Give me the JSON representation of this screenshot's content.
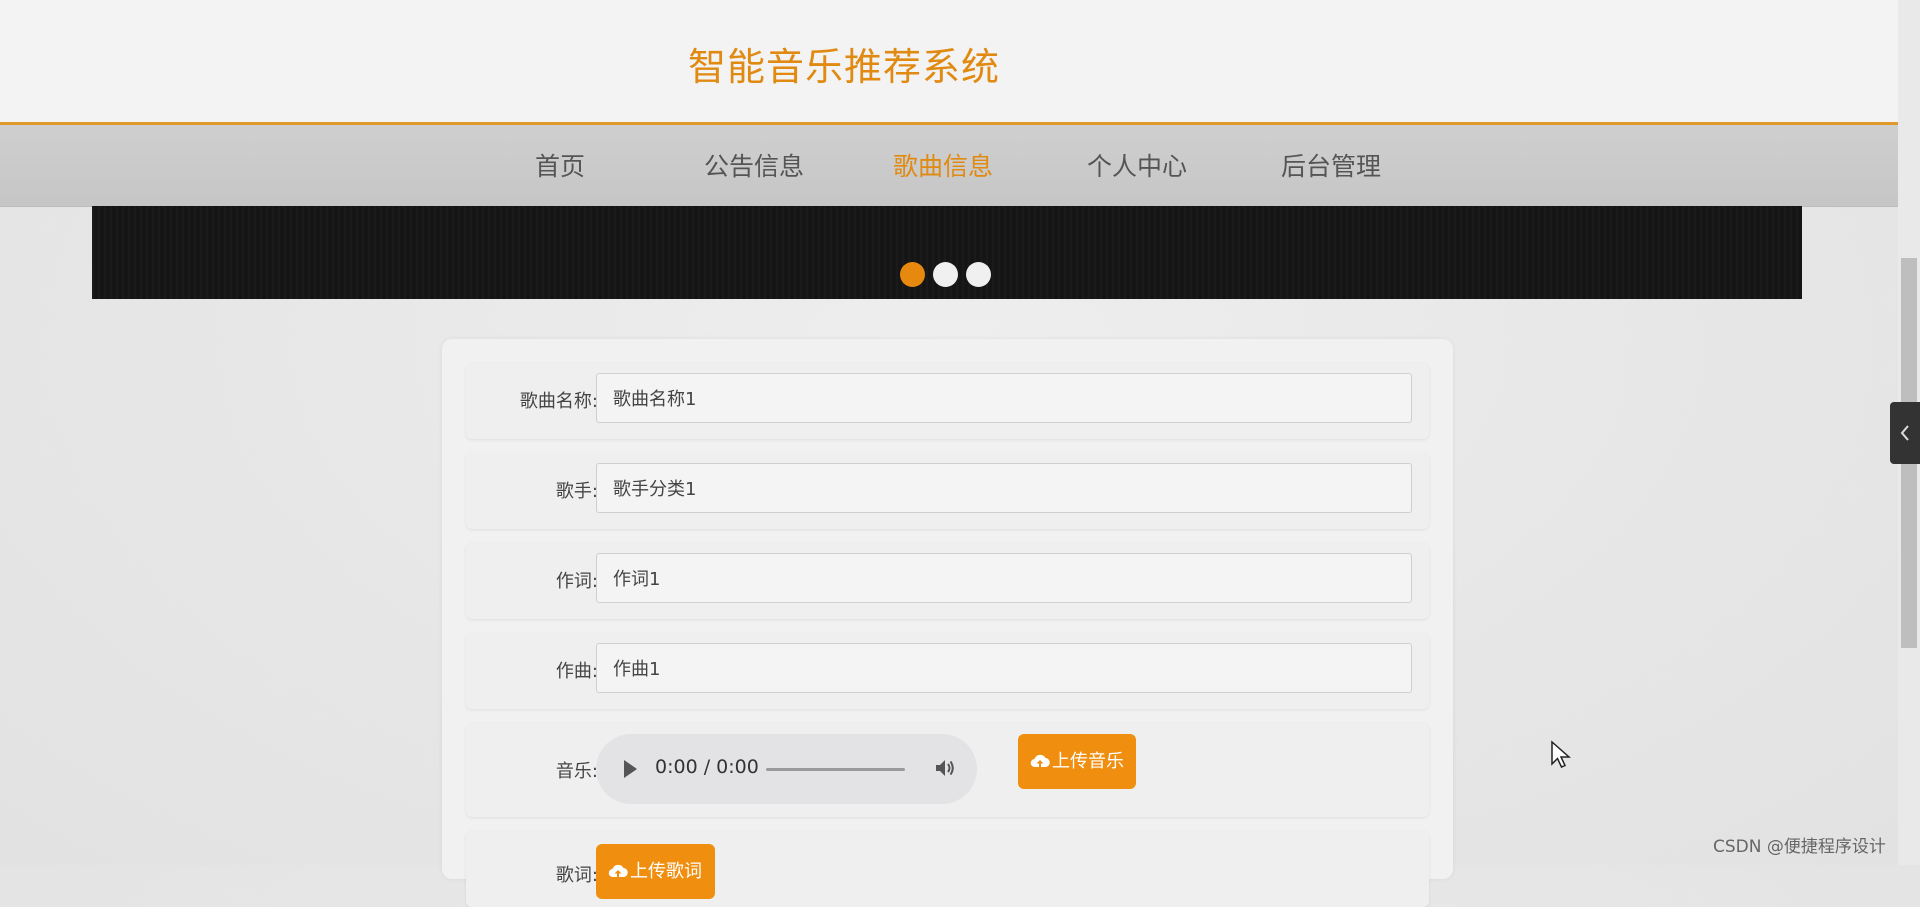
{
  "header": {
    "title": "智能音乐推荐系统"
  },
  "nav": {
    "items": [
      {
        "label": "首页"
      },
      {
        "label": "公告信息"
      },
      {
        "label": "歌曲信息",
        "active": true
      },
      {
        "label": "个人中心"
      },
      {
        "label": "后台管理"
      }
    ]
  },
  "carousel": {
    "slides": 3,
    "active_index": 0
  },
  "form": {
    "song_name": {
      "label": "歌曲名称:",
      "value": "歌曲名称1"
    },
    "singer": {
      "label": "歌手:",
      "value": "歌手分类1"
    },
    "lyricist": {
      "label": "作词:",
      "value": "作词1"
    },
    "composer": {
      "label": "作曲:",
      "value": "作曲1"
    },
    "music": {
      "label": "音乐:",
      "player_time": "0:00 / 0:00",
      "upload_label": "上传音乐"
    },
    "lyrics": {
      "label": "歌词:",
      "upload_label": "上传歌词"
    }
  },
  "watermark": "CSDN @便捷程序设计",
  "colors": {
    "accent": "#ef8e0f",
    "title": "#e08a12",
    "nav_bg": "#c8c8c8"
  }
}
